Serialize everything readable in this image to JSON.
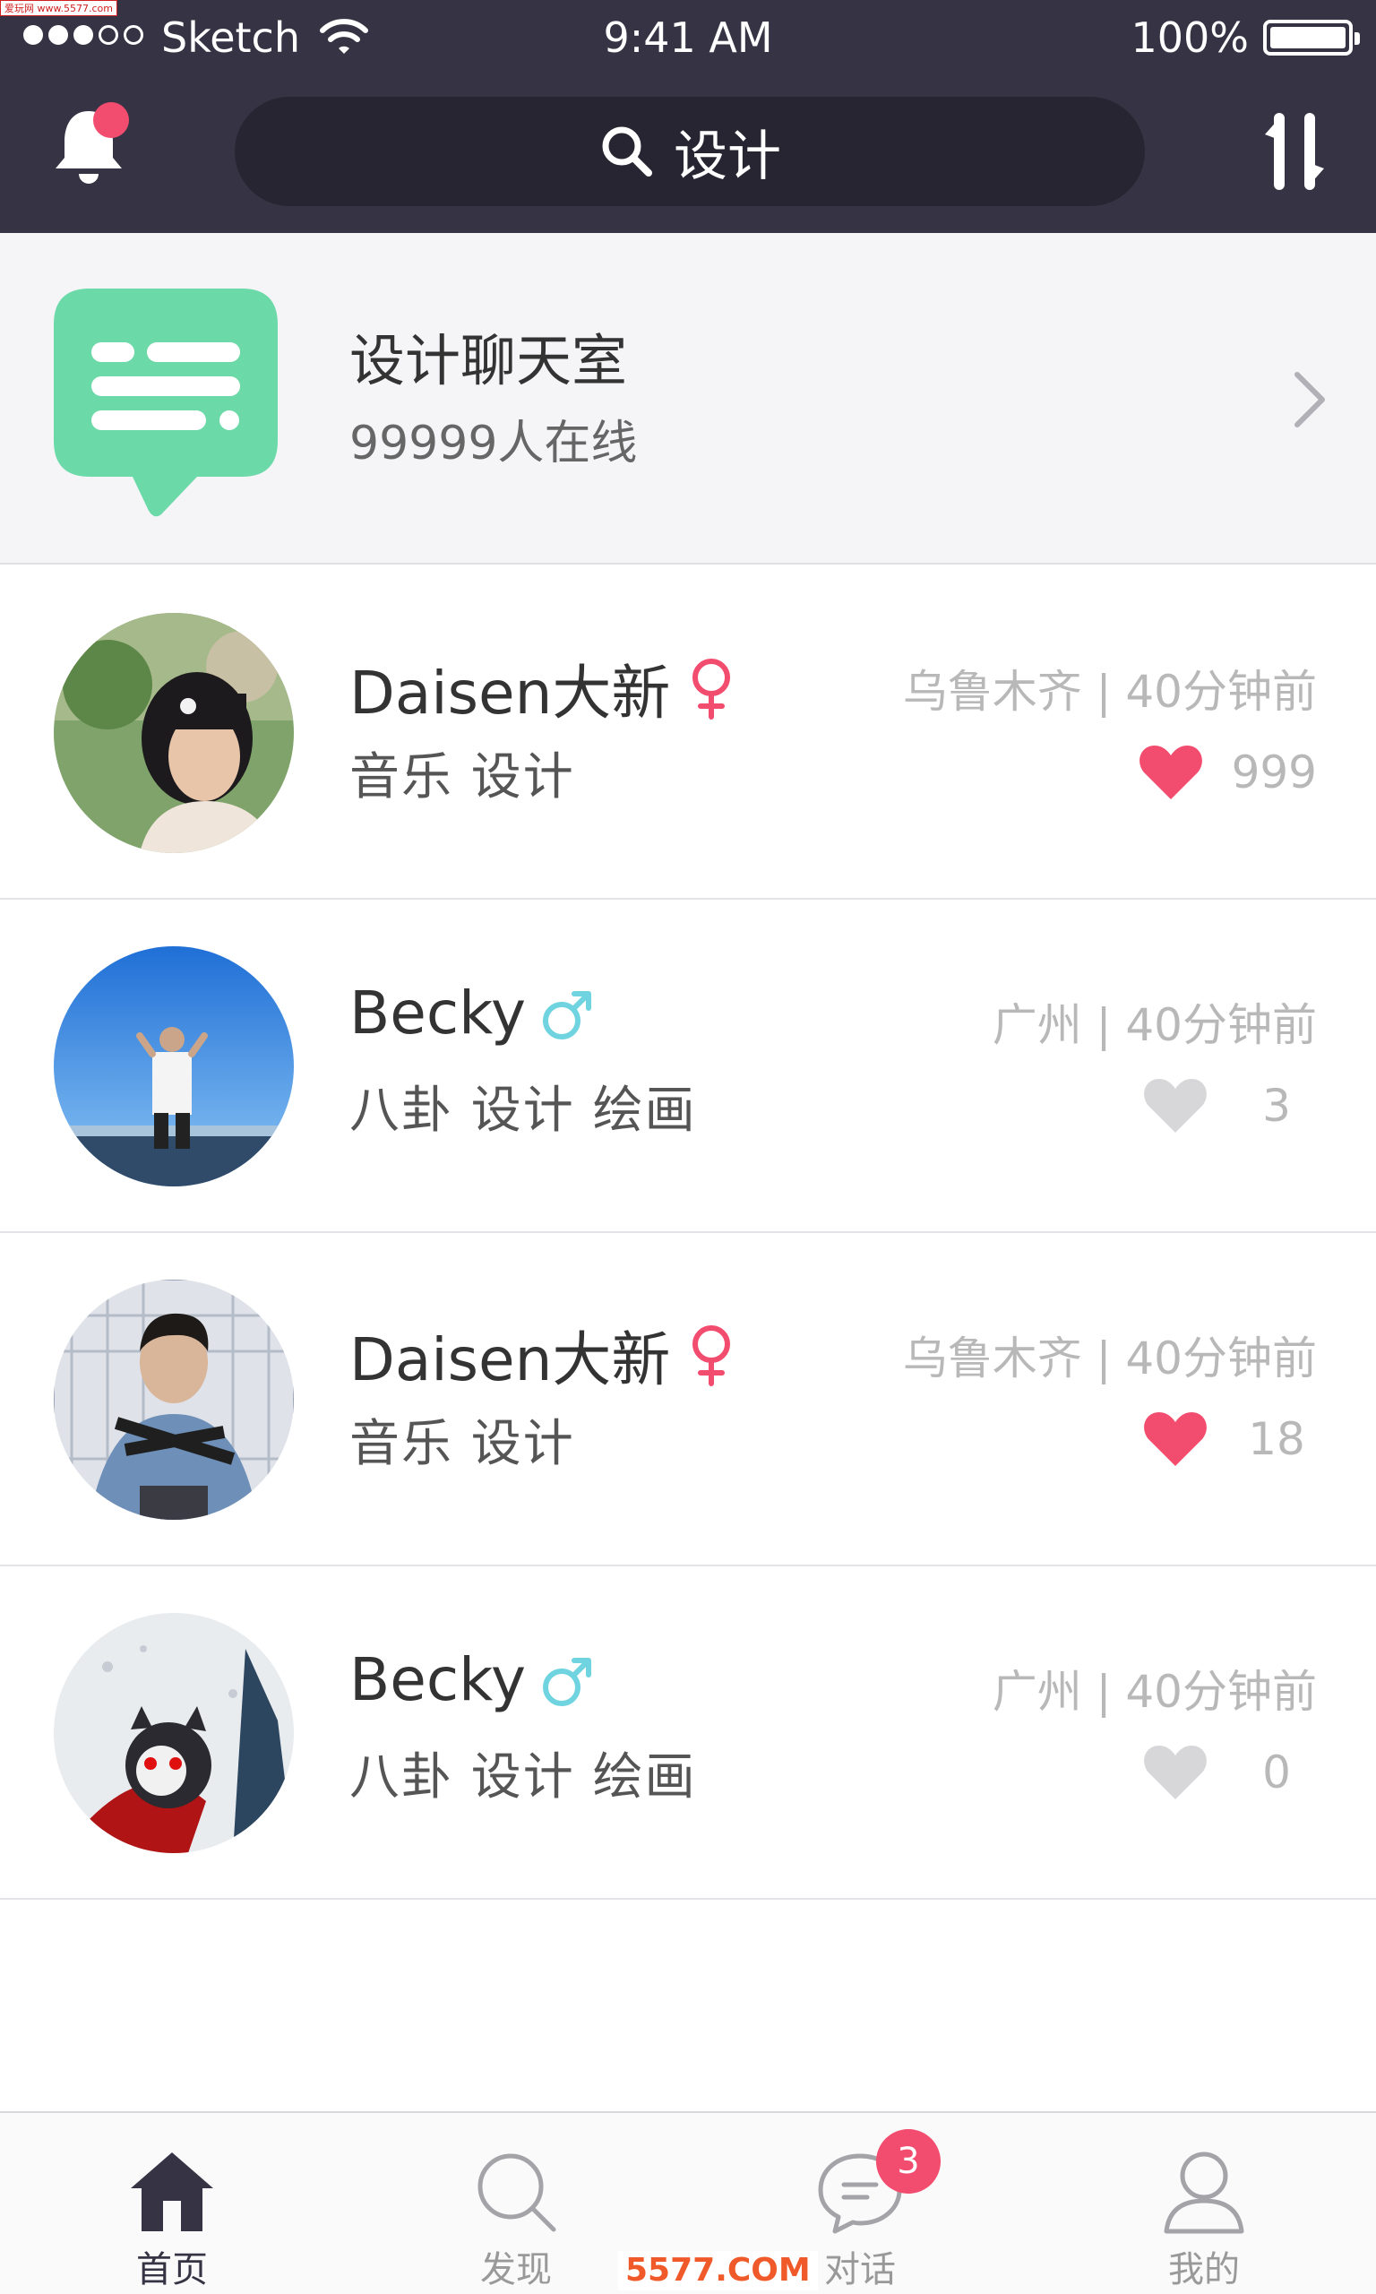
{
  "watermark_top": "爱玩网 www.5577.com",
  "watermark_bottom": "5577.COM",
  "status": {
    "carrier": "Sketch",
    "time": "9:41 AM",
    "battery": "100%"
  },
  "header": {
    "search_text": "设计",
    "icons": [
      "bell-icon",
      "search-icon",
      "sort-icon"
    ]
  },
  "chatroom": {
    "title": "设计聊天室",
    "subtitle": "99999人在线"
  },
  "users": [
    {
      "name": "Daisen大新",
      "gender": "female",
      "tags": "音乐  设计",
      "location_time": "乌鲁木齐 | 40分钟前",
      "likes": "999",
      "liked": true
    },
    {
      "name": "Becky",
      "gender": "male",
      "tags": "八卦  设计  绘画",
      "location_time": "广州 | 40分钟前",
      "likes": "3",
      "liked": false
    },
    {
      "name": "Daisen大新",
      "gender": "female",
      "tags": "音乐  设计",
      "location_time": "乌鲁木齐 | 40分钟前",
      "likes": "18",
      "liked": true
    },
    {
      "name": "Becky",
      "gender": "male",
      "tags": "八卦  设计  绘画",
      "location_time": "广州 | 40分钟前",
      "likes": "0",
      "liked": false
    }
  ],
  "tabs": [
    {
      "label": "首页",
      "icon": "home-icon",
      "active": true
    },
    {
      "label": "发现",
      "icon": "discover-icon",
      "active": false
    },
    {
      "label": "对话",
      "icon": "chat-icon",
      "active": false,
      "badge": "3"
    },
    {
      "label": "我的",
      "icon": "profile-icon",
      "active": false
    }
  ],
  "colors": {
    "header_bg": "#363444",
    "accent_pink": "#f24c6e",
    "male_blue": "#6fd3e0",
    "chat_green": "#6cd9a8"
  }
}
